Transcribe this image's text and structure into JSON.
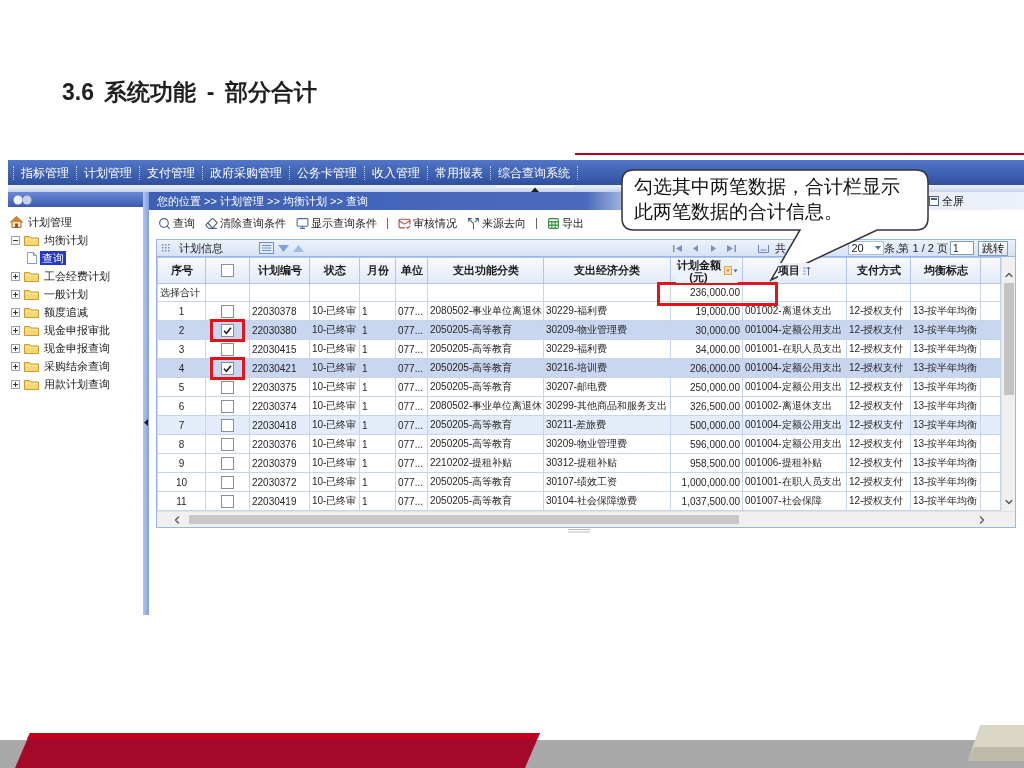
{
  "slide": {
    "title": "3.6 系统功能 - 部分合计"
  },
  "menu_bar": {
    "items": [
      "指标管理",
      "计划管理",
      "支付管理",
      "政府采购管理",
      "公务卡管理",
      "收入管理",
      "常用报表",
      "综合查询系统"
    ]
  },
  "sidebar": {
    "tree": [
      {
        "label": "计划管理",
        "kind": "root",
        "selected": false,
        "children": [
          {
            "label": "均衡计划",
            "kind": "folder",
            "expanded": true,
            "selected": false,
            "children": [
              {
                "label": "查询",
                "kind": "page",
                "selected": true
              }
            ]
          },
          {
            "label": "工会经费计划",
            "kind": "folder",
            "expanded": false,
            "selected": false
          },
          {
            "label": "一般计划",
            "kind": "folder",
            "expanded": false,
            "selected": false
          },
          {
            "label": "额度追减",
            "kind": "folder",
            "expanded": false,
            "selected": false
          },
          {
            "label": "现金申报审批",
            "kind": "folder",
            "expanded": false,
            "selected": false
          },
          {
            "label": "现金申报查询",
            "kind": "folder",
            "expanded": false,
            "selected": false
          },
          {
            "label": "采购结余查询",
            "kind": "folder",
            "expanded": false,
            "selected": false
          },
          {
            "label": "用款计划查询",
            "kind": "folder",
            "expanded": false,
            "selected": false
          }
        ]
      }
    ]
  },
  "breadcrumb": "您的位置 >> 计划管理 >> 均衡计划 >> 查询",
  "fullscreen_button": "全屏",
  "toolbar": [
    {
      "kind": "button",
      "label": "查询"
    },
    {
      "kind": "button",
      "label": "清除查询条件"
    },
    {
      "kind": "button",
      "label": "显示查询条件"
    },
    {
      "kind": "separator"
    },
    {
      "kind": "button",
      "label": "审核情况"
    },
    {
      "kind": "button",
      "label": "来源去向"
    },
    {
      "kind": "separator"
    },
    {
      "kind": "button",
      "label": "导出"
    }
  ],
  "panel": {
    "title": "计划信息",
    "pagination": {
      "total_prefix": "共",
      "page_size": "20",
      "page_status": "条,第 1 / 2 页",
      "page_input": "1",
      "go_button": "跳转"
    }
  },
  "table": {
    "select_all": {
      "checked": false
    },
    "columns": [
      {
        "kind": "index",
        "label": "序号",
        "sorted": false
      },
      {
        "kind": "text",
        "label": "计划编号",
        "sorted": false
      },
      {
        "kind": "text",
        "label": "状态",
        "sorted": false
      },
      {
        "kind": "text",
        "label": "月份",
        "sorted": false
      },
      {
        "kind": "text",
        "label": "单位",
        "sorted": false
      },
      {
        "kind": "text",
        "label": "支出功能分类",
        "sorted": false
      },
      {
        "kind": "text",
        "label": "支出经济分类",
        "sorted": false
      },
      {
        "kind": "amount",
        "label": "计划金额(元)",
        "sorted": false
      },
      {
        "kind": "text",
        "label": "项目",
        "sorted": true
      },
      {
        "kind": "text",
        "label": "支付方式",
        "sorted": false
      },
      {
        "kind": "text",
        "label": "均衡标志",
        "sorted": false
      }
    ],
    "total_row": {
      "label": "选择合计",
      "amount": "236,000.00",
      "marked": true
    },
    "rows": [
      {
        "cells": [
          "1",
          "22030378",
          "10-已终审",
          "1",
          "077...",
          "2080502-事业单位离退休",
          "30229-福利费",
          "19,000.00",
          "001002-离退休支出",
          "12-授权支付",
          "13-按半年均衡"
        ],
        "checked": false,
        "hovered": false,
        "marked": false
      },
      {
        "cells": [
          "2",
          "22030380",
          "10-已终审",
          "1",
          "077...",
          "2050205-高等教育",
          "30209-物业管理费",
          "30,000.00",
          "001004-定额公用支出",
          "12-授权支付",
          "13-按半年均衡"
        ],
        "checked": true,
        "hovered": false,
        "marked": true
      },
      {
        "cells": [
          "3",
          "22030415",
          "10-已终审",
          "1",
          "077...",
          "2050205-高等教育",
          "30229-福利费",
          "34,000.00",
          "001001-在职人员支出",
          "12-授权支付",
          "13-按半年均衡"
        ],
        "checked": false,
        "hovered": false,
        "marked": false
      },
      {
        "cells": [
          "4",
          "22030421",
          "10-已终审",
          "1",
          "077...",
          "2050205-高等教育",
          "30216-培训费",
          "206,000.00",
          "001004-定额公用支出",
          "12-授权支付",
          "13-按半年均衡"
        ],
        "checked": true,
        "hovered": false,
        "marked": true
      },
      {
        "cells": [
          "5",
          "22030375",
          "10-已终审",
          "1",
          "077...",
          "2050205-高等教育",
          "30207-邮电费",
          "250,000.00",
          "001004-定额公用支出",
          "12-授权支付",
          "13-按半年均衡"
        ],
        "checked": false,
        "hovered": false,
        "marked": false
      },
      {
        "cells": [
          "6",
          "22030374",
          "10-已终审",
          "1",
          "077...",
          "2080502-事业单位离退休",
          "30299-其他商品和服务支出",
          "326,500.00",
          "001002-离退休支出",
          "12-授权支付",
          "13-按半年均衡"
        ],
        "checked": false,
        "hovered": false,
        "marked": false
      },
      {
        "cells": [
          "7",
          "22030418",
          "10-已终审",
          "1",
          "077...",
          "2050205-高等教育",
          "30211-差旅费",
          "500,000.00",
          "001004-定额公用支出",
          "12-授权支付",
          "13-按半年均衡"
        ],
        "checked": false,
        "hovered": true,
        "marked": false
      },
      {
        "cells": [
          "8",
          "22030376",
          "10-已终审",
          "1",
          "077...",
          "2050205-高等教育",
          "30209-物业管理费",
          "596,000.00",
          "001004-定额公用支出",
          "12-授权支付",
          "13-按半年均衡"
        ],
        "checked": false,
        "hovered": false,
        "marked": false
      },
      {
        "cells": [
          "9",
          "22030379",
          "10-已终审",
          "1",
          "077...",
          "2210202-提租补贴",
          "30312-提租补贴",
          "958,500.00",
          "001006-提租补贴",
          "12-授权支付",
          "13-按半年均衡"
        ],
        "checked": false,
        "hovered": false,
        "marked": false
      },
      {
        "cells": [
          "10",
          "22030372",
          "10-已终审",
          "1",
          "077...",
          "2050205-高等教育",
          "30107-绩效工资",
          "1,000,000.00",
          "001001-在职人员支出",
          "12-授权支付",
          "13-按半年均衡"
        ],
        "checked": false,
        "hovered": false,
        "marked": false
      },
      {
        "cells": [
          "11",
          "22030419",
          "10-已终审",
          "1",
          "077...",
          "2050205-高等教育",
          "30104-社会保障缴费",
          "1,037,500.00",
          "001007-社会保障",
          "12-授权支付",
          "13-按半年均衡"
        ],
        "checked": false,
        "hovered": false,
        "marked": false
      }
    ]
  },
  "callout": "勾选其中两笔数据，合计栏显示此两笔数据的合计信息。"
}
